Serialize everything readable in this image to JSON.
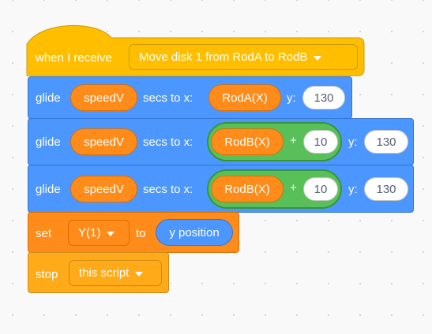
{
  "hat": {
    "label": "when I receive",
    "message": "Move disk 1 from RodA to RodB"
  },
  "glide1": {
    "verb": "glide",
    "secs_var": "speedV",
    "secs_label": "secs to x:",
    "x_reporter": "RodA(X)",
    "y_label": "y:",
    "y_value": "130"
  },
  "glide2": {
    "verb": "glide",
    "secs_var": "speedV",
    "secs_label": "secs to x:",
    "x_reporter": "RodB(X)",
    "op": "+",
    "op_value": "10",
    "y_label": "y:",
    "y_value": "130"
  },
  "glide3": {
    "verb": "glide",
    "secs_var": "speedV",
    "secs_label": "secs to x:",
    "x_reporter": "RodB(X)",
    "op": "+",
    "op_value": "10",
    "y_label": "y:",
    "y_value": "130"
  },
  "set": {
    "verb": "set",
    "variable": "Y(1)",
    "to_label": "to",
    "value_reporter": "y position"
  },
  "stop": {
    "verb": "stop",
    "option": "this script"
  },
  "colors": {
    "events": "#ffbf00",
    "motion": "#4c97ff",
    "variables": "#ff8c1a",
    "control": "#ffab19",
    "operators": "#59c059"
  }
}
